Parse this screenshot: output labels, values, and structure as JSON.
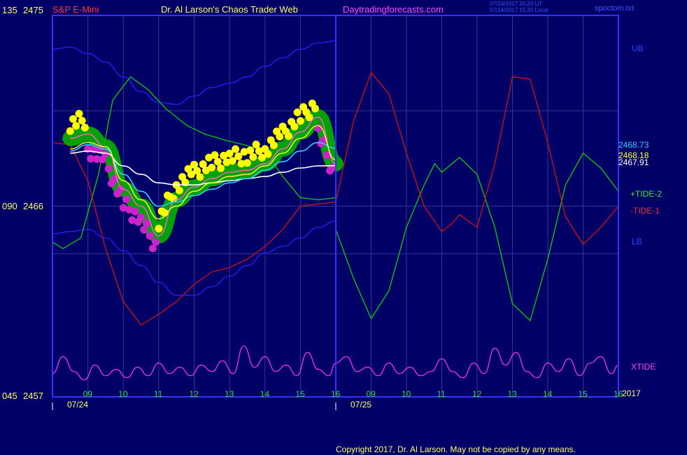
{
  "header": {
    "symbol": "S&P E-Mini",
    "site_name": "Dr. Al Larson's Chaos Trader Web",
    "site_url": "Daytradingforecasts.com",
    "timestamp_ut": "07/24/2017 20:20 UT",
    "timestamp_local": "07/24/2017 15:20 Local",
    "file_name": "spoctom.txt"
  },
  "footer": {
    "copyright": "Copyright 2017, Dr. Al Larson. May not be copied by any means."
  },
  "colors": {
    "background": "#000066",
    "frame": "#3333ff",
    "grid": "#333399",
    "upper_band": "#2222ff",
    "tide2": "#00dd00",
    "tide1": "#dd1111",
    "xtide": "#ff33ff",
    "price_glow": "#00aa00",
    "price_yellow": "#ffff00",
    "price_magenta": "#cc22cc",
    "fast_ma": "#ffff33",
    "mid_ma": "#33ccff",
    "slow_ma": "#ffffff"
  },
  "chart_data": {
    "type": "line",
    "x_unit": "hours (ET), day 1 = 07/24, day 2 = 07/25",
    "x_ticks_day1": [
      "09",
      "10",
      "11",
      "12",
      "13",
      "14",
      "15",
      "16"
    ],
    "x_ticks_day2": [
      "09",
      "10",
      "11",
      "12",
      "13",
      "14",
      "15",
      "16"
    ],
    "date_labels": [
      "07/24",
      "07/25"
    ],
    "year_label": "2017",
    "y_axis_labels": [
      {
        "left": "135",
        "right": "2475",
        "value": 2475
      },
      {
        "left": "090",
        "right": "2466",
        "value": 2466
      },
      {
        "left": "045",
        "right": "2457",
        "value": 2457
      }
    ],
    "ylim": [
      2457,
      2475
    ],
    "right_values": {
      "mid_ma_last": "2468.73",
      "fast_ma_last": "2468.18",
      "slow_ma_last": "2467.91"
    },
    "series_labels": {
      "upper_band": "UB",
      "lower_band": "LB",
      "tide2": "+TIDE-2",
      "tide1": "-TIDE-1",
      "xtide": "XTIDE"
    },
    "x_hours": [
      8.5,
      9.0,
      9.5,
      10.0,
      10.5,
      11.0,
      11.5,
      12.0,
      12.5,
      13.0,
      13.5,
      14.0,
      14.5,
      15.0,
      15.5,
      16.0
    ],
    "price": [
      2469.2,
      2469.4,
      2468.8,
      2466.8,
      2466.0,
      2464.6,
      2466.3,
      2466.9,
      2467.3,
      2467.6,
      2467.7,
      2468.0,
      2468.7,
      2469.5,
      2470.2,
      2468.0
    ],
    "fast_ma": [
      2468.7,
      2469.0,
      2468.8,
      2467.2,
      2466.3,
      2465.4,
      2466.0,
      2466.7,
      2467.1,
      2467.4,
      2467.5,
      2467.9,
      2468.5,
      2469.2,
      2469.8,
      2468.18
    ],
    "mid_ma": [
      2468.6,
      2468.9,
      2468.7,
      2467.5,
      2466.7,
      2466.0,
      2466.2,
      2466.5,
      2466.8,
      2467.1,
      2467.3,
      2467.7,
      2468.1,
      2468.6,
      2469.0,
      2468.73
    ],
    "slow_ma": [
      2468.5,
      2468.6,
      2468.5,
      2467.9,
      2467.5,
      2467.1,
      2467.0,
      2467.0,
      2467.1,
      2467.2,
      2467.3,
      2467.4,
      2467.6,
      2467.8,
      2467.9,
      2467.91
    ],
    "upper_band": {
      "x": [
        8.0,
        8.5,
        9.0,
        9.5,
        10.0,
        10.5,
        11.0,
        11.5,
        12.0,
        12.5,
        13.0,
        13.5,
        14.0,
        14.5,
        15.0,
        15.5,
        16.0
      ],
      "y": [
        2473.4,
        2473.5,
        2473.2,
        2472.8,
        2472.1,
        2471.4,
        2470.9,
        2470.8,
        2471.2,
        2471.6,
        2471.8,
        2472.1,
        2472.6,
        2473.0,
        2473.4,
        2473.7,
        2473.8
      ]
    },
    "lower_band": {
      "x": [
        8.0,
        8.5,
        9.0,
        9.5,
        10.0,
        10.5,
        11.0,
        11.5,
        12.0,
        12.5,
        13.0,
        13.5,
        14.0,
        14.5,
        15.0,
        15.5,
        16.0
      ],
      "y": [
        2464.7,
        2464.8,
        2464.9,
        2464.5,
        2463.9,
        2463.2,
        2462.4,
        2461.8,
        2461.8,
        2462.2,
        2462.7,
        2463.2,
        2463.8,
        2464.1,
        2464.5,
        2465.0,
        2465.3
      ]
    },
    "tide2": {
      "x": [
        8.0,
        8.3,
        8.8,
        9.3,
        9.7,
        10.2,
        10.7,
        11.2,
        11.8,
        12.3,
        12.9,
        13.4,
        14.0,
        14.5,
        15.0,
        15.5,
        16.0,
        16.0,
        16.5,
        17.0,
        17.5,
        18.0,
        18.5,
        18.8,
        19.0,
        19.5,
        20.0,
        20.5,
        21.0,
        21.5,
        22.0,
        22.5,
        23.0,
        23.5,
        24.0
      ],
      "y": [
        2464.3,
        2464.0,
        2464.5,
        2467.5,
        2471.0,
        2472.1,
        2471.5,
        2470.6,
        2469.8,
        2469.4,
        2469.1,
        2468.9,
        2468.6,
        2467.4,
        2466.4,
        2466.3,
        2466.4,
        2464.9,
        2462.6,
        2460.7,
        2462.0,
        2465.0,
        2467.0,
        2468.0,
        2467.6,
        2468.3,
        2467.5,
        2465.0,
        2461.4,
        2460.6,
        2463.5,
        2467.0,
        2468.5,
        2467.8,
        2466.7
      ]
    },
    "tide1": {
      "x": [
        8.0,
        8.5,
        9.0,
        9.5,
        10.0,
        10.5,
        11.0,
        11.5,
        12.0,
        12.5,
        13.0,
        13.5,
        14.0,
        14.5,
        15.0,
        15.5,
        16.0,
        16.5,
        17.0,
        17.5,
        18.0,
        18.5,
        19.0,
        19.3,
        19.5,
        20.0,
        20.5,
        21.0,
        21.5,
        22.0,
        22.5,
        23.0,
        23.5,
        24.0
      ],
      "y": [
        2469.0,
        2468.9,
        2467.2,
        2464.0,
        2461.5,
        2460.4,
        2460.9,
        2461.5,
        2462.3,
        2462.9,
        2463.1,
        2463.5,
        2464.1,
        2464.9,
        2466.0,
        2466.1,
        2466.2,
        2470.0,
        2472.3,
        2471.3,
        2468.5,
        2466.0,
        2464.8,
        2465.2,
        2465.6,
        2465.0,
        2468.0,
        2472.1,
        2472.0,
        2469.0,
        2465.5,
        2464.2,
        2465.0,
        2466.0
      ]
    },
    "xtide": {
      "x": [
        8.0,
        8.3,
        8.6,
        8.9,
        9.2,
        9.5,
        9.8,
        10.1,
        10.4,
        10.7,
        11.0,
        11.3,
        11.6,
        11.9,
        12.2,
        12.5,
        12.8,
        13.1,
        13.4,
        13.7,
        14.0,
        14.3,
        14.6,
        14.9,
        15.2,
        15.5,
        15.8,
        16.0,
        16.3,
        16.6,
        16.9,
        17.2,
        17.5,
        17.8,
        18.1,
        18.4,
        18.7,
        19.0,
        19.3,
        19.6,
        19.9,
        20.2,
        20.5,
        20.8,
        21.1,
        21.4,
        21.7,
        22.0,
        22.3,
        22.6,
        22.9,
        23.2,
        23.5,
        23.8,
        24.0
      ],
      "y": [
        2458.1,
        2458.9,
        2458.2,
        2457.8,
        2458.5,
        2458.0,
        2458.3,
        2457.9,
        2458.4,
        2458.0,
        2458.6,
        2458.1,
        2458.4,
        2458.0,
        2458.5,
        2458.2,
        2458.7,
        2458.1,
        2459.4,
        2458.4,
        2458.9,
        2458.2,
        2458.5,
        2458.0,
        2459.1,
        2458.3,
        2458.0,
        2458.6,
        2458.9,
        2458.2,
        2458.4,
        2458.0,
        2458.6,
        2458.1,
        2458.4,
        2458.0,
        2458.2,
        2458.8,
        2458.2,
        2457.9,
        2458.6,
        2458.1,
        2459.3,
        2458.5,
        2459.1,
        2458.2,
        2457.9,
        2458.6,
        2458.2,
        2458.8,
        2458.0,
        2458.6,
        2458.9,
        2458.1,
        2458.5
      ]
    }
  }
}
